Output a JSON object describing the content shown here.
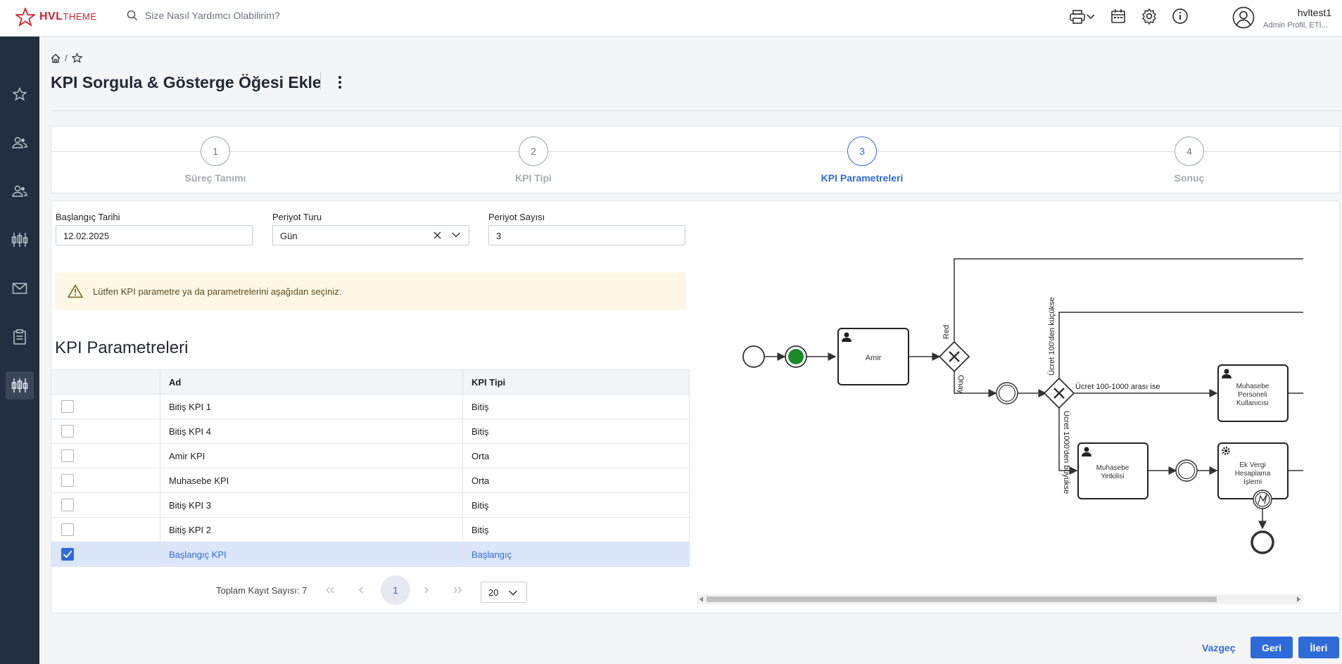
{
  "header": {
    "logo": {
      "brand": "HVL",
      "suffix": "THEME"
    },
    "search_placeholder": "Size Nasıl Yardımcı Olabilirim?",
    "user": {
      "name": "hvltest1",
      "role": "Admin Profil, ETİ..."
    }
  },
  "breadcrumb": {
    "separator": "/"
  },
  "page": {
    "title": "KPI Sorgula & Gösterge Öğesi Ekle"
  },
  "steps": [
    {
      "number": "1",
      "label": "Süreç Tanımı",
      "active": false
    },
    {
      "number": "2",
      "label": "KPI Tipi",
      "active": false
    },
    {
      "number": "3",
      "label": "KPI Parametreleri",
      "active": true
    },
    {
      "number": "4",
      "label": "Sonuç",
      "active": false
    }
  ],
  "form": {
    "start_date": {
      "label": "Başlangıç Tarihi",
      "value": "12.02.2025"
    },
    "period_type": {
      "label": "Periyot Turu",
      "value": "Gün"
    },
    "period_count": {
      "label": "Periyot Sayısı",
      "value": "3"
    }
  },
  "alert": {
    "text": "Lütfen KPI parametre ya da parametrelerini aşağıdan seçiniz."
  },
  "kpi_section": {
    "title": "KPI Parametreleri"
  },
  "table": {
    "columns": [
      "",
      "Ad",
      "KPI Tipi"
    ],
    "rows": [
      {
        "name": "Bitiş KPI 1",
        "type": "Bitiş",
        "checked": false
      },
      {
        "name": "Bitiş KPI 4",
        "type": "Bitiş",
        "checked": false
      },
      {
        "name": "Amir KPI",
        "type": "Orta",
        "checked": false
      },
      {
        "name": "Muhasebe KPI",
        "type": "Orta",
        "checked": false
      },
      {
        "name": "Bitiş KPI 3",
        "type": "Bitiş",
        "checked": false
      },
      {
        "name": "Bitiş KPI 2",
        "type": "Bitiş",
        "checked": false
      },
      {
        "name": "Başlangıç KPI",
        "type": "Başlangıç",
        "checked": true
      }
    ]
  },
  "pagination": {
    "total_label": "Toplam Kayıt Sayısı: 7",
    "current_page": "1",
    "page_size": "20"
  },
  "diagram": {
    "tasks": {
      "amir": "Amir",
      "muhasebe_personeli": [
        "Muhasebe",
        "Personeli",
        "Kullanıcısı"
      ],
      "muhasebe_yetkilisi": [
        "Muhasebe",
        "Yetkilisi"
      ],
      "ek_vergi": [
        "Ek Vergi",
        "Hesaplama",
        "İşlemi"
      ]
    },
    "labels": {
      "red": "Red",
      "onay": "Onay",
      "kucukse": "Ücret 100'den küçükse",
      "arasi": "Ücret 100-1000 arası ise",
      "buyukse": "Ücret 1000'den büyükse"
    }
  },
  "actions": {
    "cancel": "Vazgeç",
    "back": "Geri",
    "next": "İleri"
  },
  "colors": {
    "primary": "#2f6bd8",
    "brand": "#d3222e",
    "sidebar": "#232f3e"
  }
}
